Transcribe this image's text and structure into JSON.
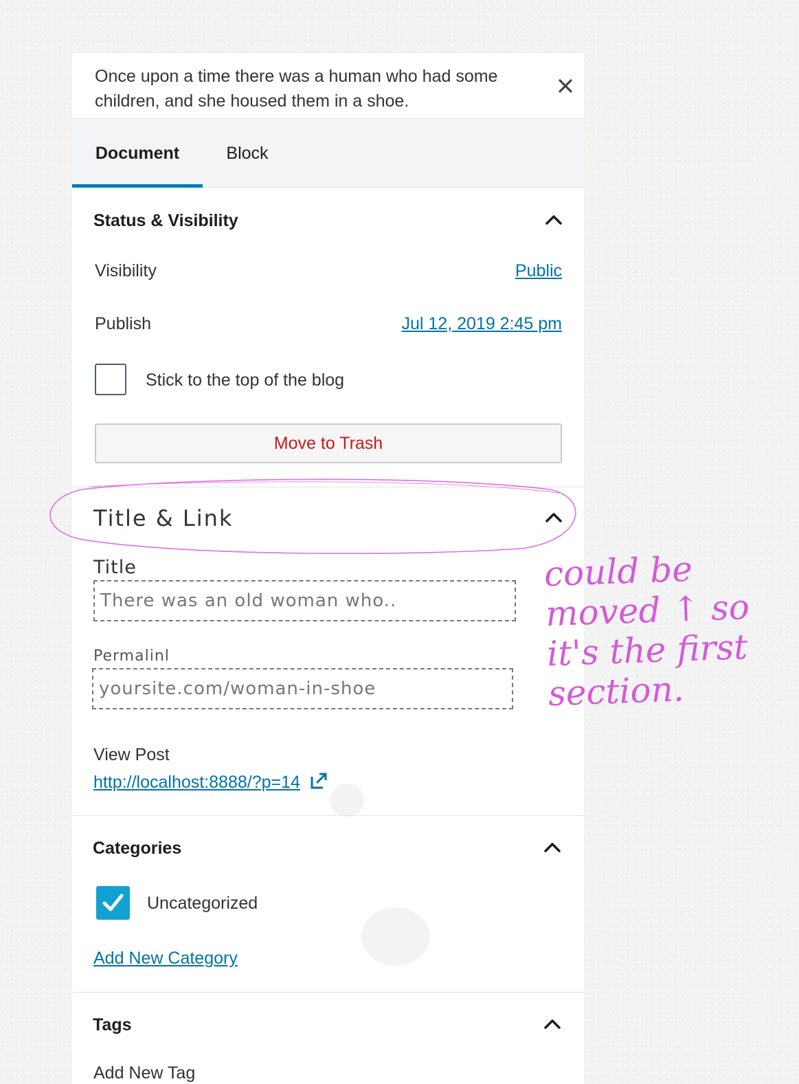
{
  "notice": {
    "text": "Once upon a time there was a human who had some children, and she housed them in a shoe.",
    "close_icon": "close-icon"
  },
  "tabs": [
    {
      "label": "Document",
      "active": true
    },
    {
      "label": "Block",
      "active": false
    }
  ],
  "status_visibility": {
    "title": "Status & Visibility",
    "visibility_label": "Visibility",
    "visibility_value": "Public",
    "publish_label": "Publish",
    "publish_value": "Jul 12, 2019 2:45 pm",
    "sticky_label": "Stick to the top of the blog",
    "sticky_checked": false,
    "trash_label": "Move to Trash"
  },
  "title_link": {
    "title": "Title & Link",
    "title_field_label": "Title",
    "title_field_value": "There was an old woman who..",
    "permalink_label": "Permalinl",
    "permalink_value": "yoursite.com/woman-in-shoe",
    "view_post_label": "View Post",
    "view_post_url": "http://localhost:8888/?p=14"
  },
  "annotation": {
    "text": "could be moved ↑ so it's the first section."
  },
  "categories": {
    "title": "Categories",
    "items": [
      {
        "label": "Uncategorized",
        "checked": true
      }
    ],
    "add_label": "Add New Category"
  },
  "tags": {
    "title": "Tags",
    "add_label": "Add New Tag"
  },
  "colors": {
    "accent": "#007cba",
    "link": "#0073aa",
    "danger": "#cc1818",
    "checkbox": "#11a0d2",
    "annotation": "#d45bd6"
  }
}
